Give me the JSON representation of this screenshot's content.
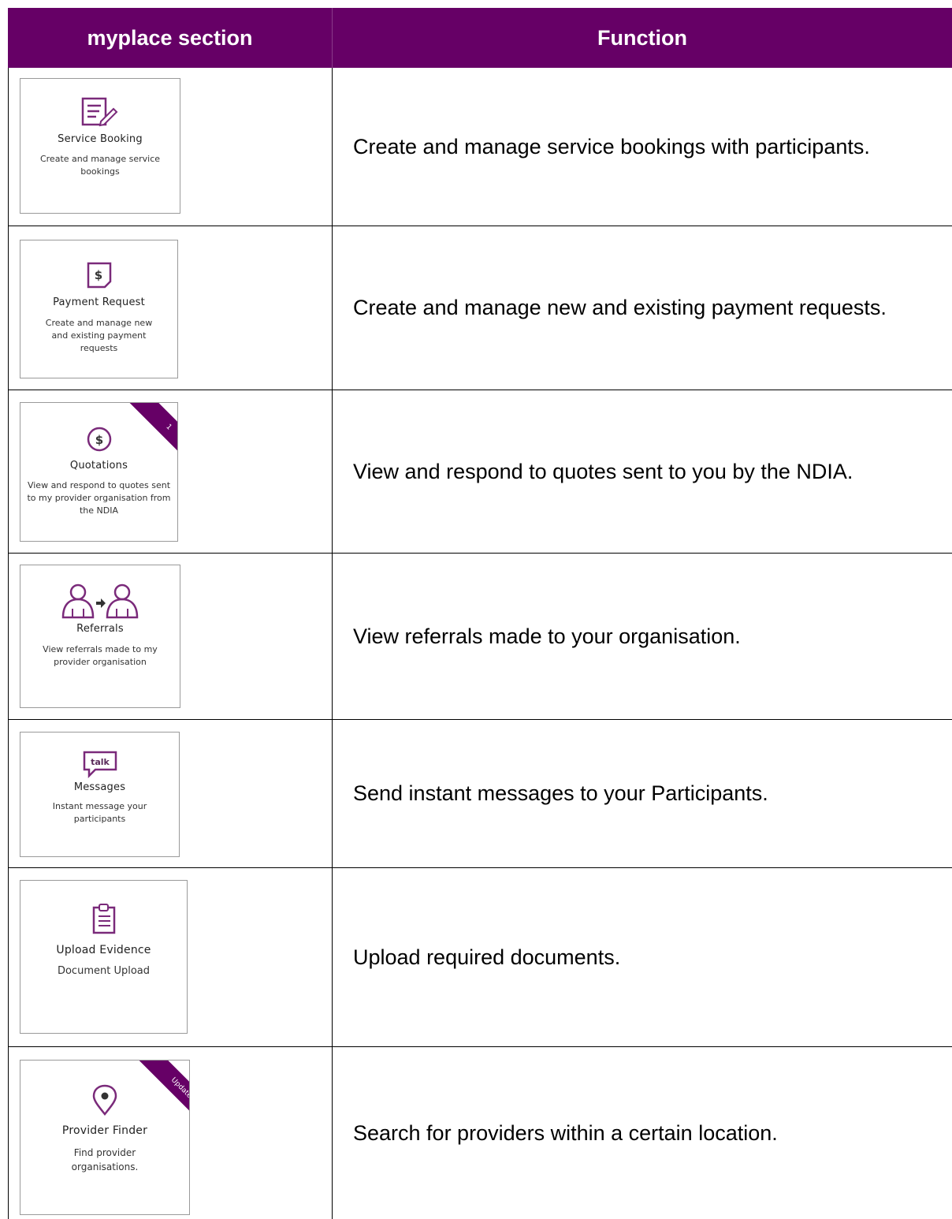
{
  "header": {
    "col1": "myplace section",
    "col2": "Function"
  },
  "rows": [
    {
      "tile_title": "Service Booking",
      "tile_desc": "Create and manage service bookings",
      "icon": "document-edit-icon",
      "function": "Create and manage service bookings with participants."
    },
    {
      "tile_title": "Payment Request",
      "tile_desc": "Create and manage new and existing payment requests",
      "icon": "dollar-document-icon",
      "icon_label": "$",
      "function": "Create and manage new and existing payment requests."
    },
    {
      "tile_title": "Quotations",
      "tile_desc": "View and respond to quotes sent to my provider organisation from the NDIA",
      "icon": "dollar-circle-icon",
      "icon_label": "$",
      "ribbon": "1",
      "function": "View and respond to quotes sent to you by the NDIA."
    },
    {
      "tile_title": "Referrals",
      "tile_desc": "View referrals made to my provider organisation",
      "icon": "person-referral-icon",
      "function": "View referrals made to your organisation."
    },
    {
      "tile_title": "Messages",
      "tile_desc": "Instant message your participants",
      "icon": "talk-bubble-icon",
      "icon_label": "talk",
      "function": "Send instant messages to your Participants."
    },
    {
      "tile_title": "Upload Evidence",
      "tile_desc": "Document Upload",
      "icon": "clipboard-icon",
      "function": "Upload required documents."
    },
    {
      "tile_title": "Provider Finder",
      "tile_desc": "Find provider organisations.",
      "icon": "location-pin-icon",
      "ribbon": "Updated",
      "function": "Search for providers within a certain location."
    }
  ],
  "colors": {
    "header_bg": "#660066",
    "icon": "#7a2a7a"
  }
}
